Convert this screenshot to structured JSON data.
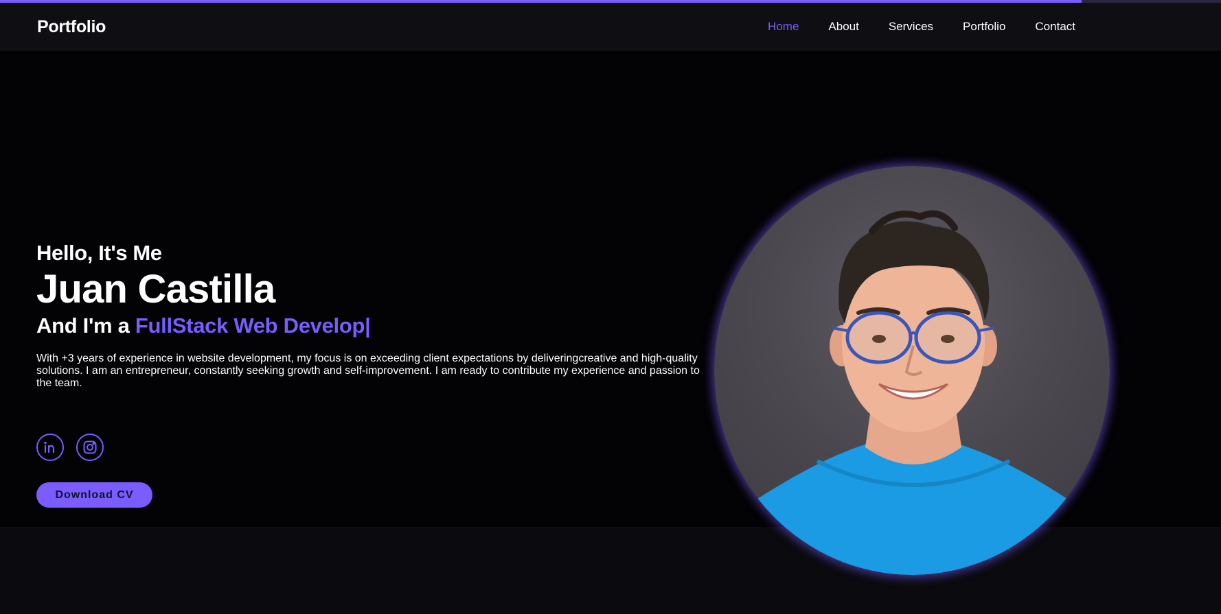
{
  "header": {
    "logo": "Portfolio",
    "nav": [
      {
        "label": "Home",
        "active": true
      },
      {
        "label": "About",
        "active": false
      },
      {
        "label": "Services",
        "active": false
      },
      {
        "label": "Portfolio",
        "active": false
      },
      {
        "label": "Contact",
        "active": false
      }
    ]
  },
  "hero": {
    "greeting": "Hello, It's Me",
    "name": "Juan Castilla",
    "role_prefix": "And I'm a ",
    "role_typed": "FullStack Web Develop|",
    "bio": "With +3 years of experience in website development, my focus is on exceeding client expectations by deliveringcreative and high-quality solutions. I am an entrepreneur, constantly seeking growth and self-improvement. I am ready to contribute my experience and passion to the team.",
    "socials": [
      {
        "icon": "linkedin-icon"
      },
      {
        "icon": "instagram-icon"
      }
    ],
    "cta_label": "Download CV",
    "photo_icon": "profile-photo"
  },
  "theme": {
    "accent": "#7a5cff",
    "background": "#030204",
    "header_background": "#0f0e13",
    "text": "#ffffff"
  }
}
